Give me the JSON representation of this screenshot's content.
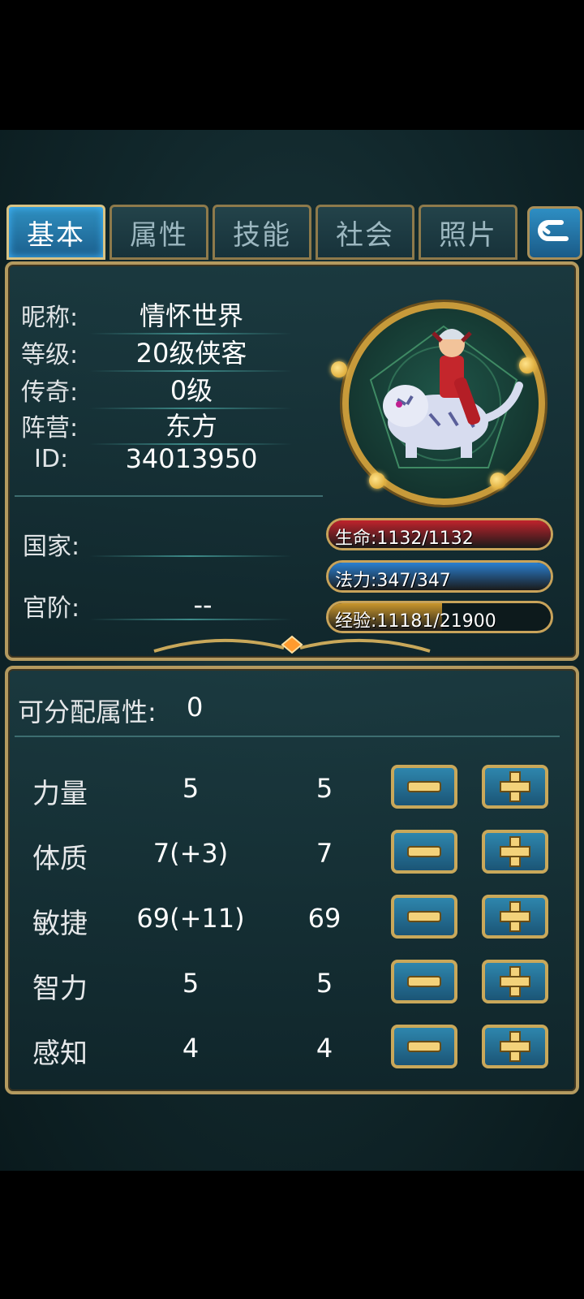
{
  "tabs": [
    {
      "label": "基本",
      "active": true
    },
    {
      "label": "属性",
      "active": false
    },
    {
      "label": "技能",
      "active": false
    },
    {
      "label": "社会",
      "active": false
    },
    {
      "label": "照片",
      "active": false
    }
  ],
  "profile": {
    "nickname_label": "昵称:",
    "nickname": "情怀世界",
    "level_label": "等级:",
    "level": "20级侠客",
    "legend_label": "传奇:",
    "legend": "0级",
    "camp_label": "阵营:",
    "camp": "东方",
    "id_label": "ID:",
    "id": "34013950",
    "country_label": "国家:",
    "country": "",
    "rank_label": "官阶:",
    "rank": "--"
  },
  "bars": {
    "hp": {
      "text": "生命:1132/1132",
      "current": 1132,
      "max": 1132,
      "color": "#c0232c"
    },
    "mp": {
      "text": "法力:347/347",
      "current": 347,
      "max": 347,
      "color": "#2a7fd0"
    },
    "exp": {
      "text": "经验:11181/21900",
      "current": 11181,
      "max": 21900,
      "color": "#c9962c"
    }
  },
  "stats": {
    "points_label": "可分配属性:",
    "points": "0",
    "rows": [
      {
        "name": "力量",
        "total": "5",
        "base": "5"
      },
      {
        "name": "体质",
        "total": "7(+3)",
        "base": "7"
      },
      {
        "name": "敏捷",
        "total": "69(+11)",
        "base": "69"
      },
      {
        "name": "智力",
        "total": "5",
        "base": "5"
      },
      {
        "name": "感知",
        "total": "4",
        "base": "4"
      }
    ]
  },
  "icons": {
    "back": "back-arrow-icon",
    "minus": "minus-icon",
    "plus": "plus-icon",
    "avatar": "character-on-white-tiger"
  }
}
